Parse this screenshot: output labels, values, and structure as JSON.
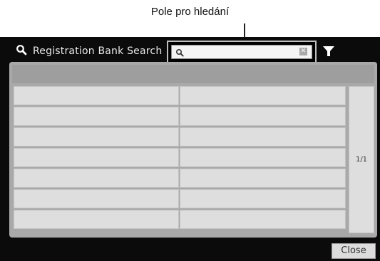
{
  "callout": {
    "label": "Pole pro hledání"
  },
  "header": {
    "title": "Registration Bank Search",
    "search_icon": "magnifier-icon",
    "filter_icon": "filter-icon"
  },
  "search": {
    "value": "",
    "clear_icon": "clear-icon"
  },
  "results": {
    "columns": 2,
    "rows": [
      [
        "",
        ""
      ],
      [
        "",
        ""
      ],
      [
        "",
        ""
      ],
      [
        "",
        ""
      ],
      [
        "",
        ""
      ],
      [
        "",
        ""
      ],
      [
        "",
        ""
      ]
    ]
  },
  "pager": {
    "page_label": "1/1"
  },
  "footer": {
    "close_label": "Close"
  }
}
